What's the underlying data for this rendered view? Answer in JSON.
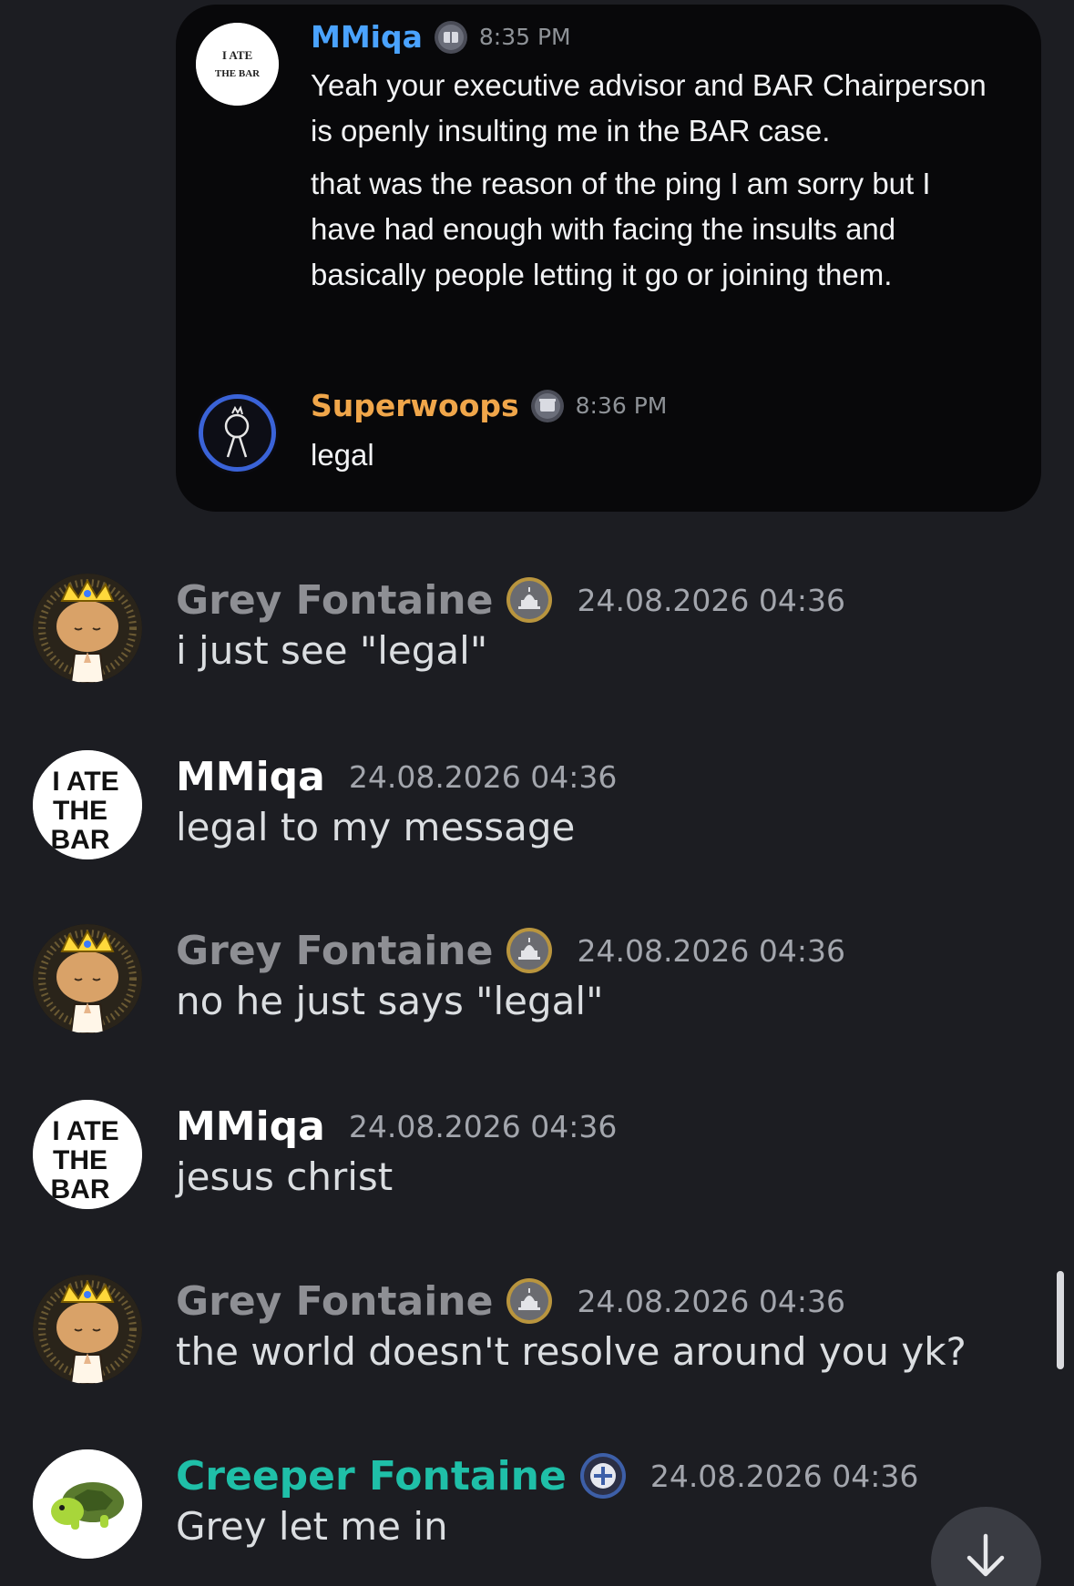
{
  "embed": {
    "messages": [
      {
        "author": "MMiqa",
        "author_color": "#4aa3ff",
        "time": "8:35 PM",
        "paragraphs": [
          "Yeah your executive advisor and BAR Chairperson is openly insulting me in the BAR case.",
          "that was the reason of the ping I am sorry but I have had enough with facing the insults and basically people letting it go or joining them."
        ],
        "avatar_text": [
          "I ATE",
          "THE BAR"
        ]
      },
      {
        "author": "Superwoops",
        "author_color": "#f0a64a",
        "time": "8:36 PM",
        "paragraphs": [
          "legal"
        ]
      }
    ]
  },
  "messages": [
    {
      "author": "Grey Fontaine",
      "author_color": "#8e8f94",
      "time": "24.08.2026 04:36",
      "text": "i just see \"legal\""
    },
    {
      "author": "MMiqa",
      "author_color": "#ffffff",
      "time": "24.08.2026 04:36",
      "text": "legal to my message",
      "avatar_lines": [
        "I ATE",
        "THE",
        "BAR"
      ]
    },
    {
      "author": "Grey Fontaine",
      "author_color": "#8e8f94",
      "time": "24.08.2026 04:36",
      "text": "no he just says \"legal\""
    },
    {
      "author": "MMiqa",
      "author_color": "#ffffff",
      "time": "24.08.2026 04:36",
      "text": "jesus christ",
      "avatar_lines": [
        "I ATE",
        "THE",
        "BAR"
      ]
    },
    {
      "author": "Grey Fontaine",
      "author_color": "#8e8f94",
      "time": "24.08.2026 04:36",
      "text": "the world doesn't resolve around you yk?"
    },
    {
      "author": "Creeper Fontaine",
      "author_color": "#1fbfa8",
      "time": "24.08.2026 04:36",
      "text": "Grey let me in"
    }
  ],
  "icons": {
    "capitol_badge": "capitol-badge-icon",
    "court_badge": "court-badge-icon",
    "cross_shield_badge": "cross-shield-badge-icon",
    "jump_to_bottom": "arrow-down-icon"
  }
}
